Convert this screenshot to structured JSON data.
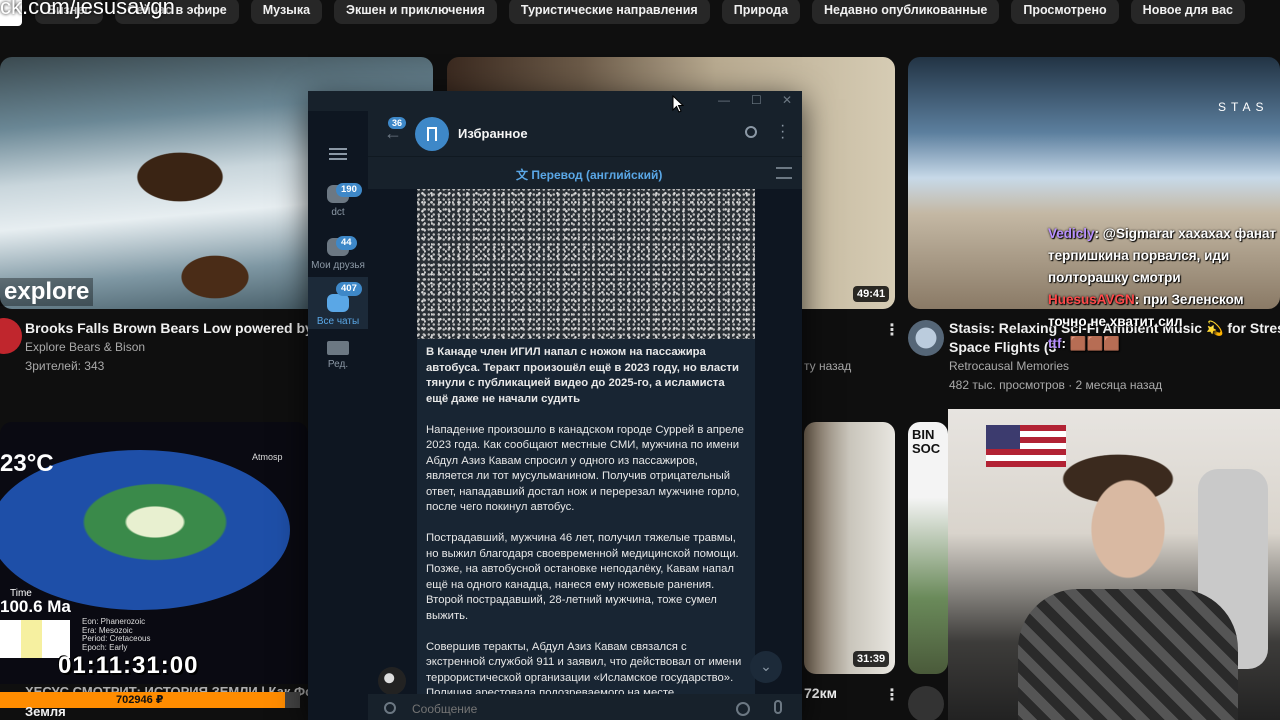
{
  "overlay_url": "ck.com/jesusavgn",
  "chips": [
    "Бизнес",
    "Сейчас в эфире",
    "Музыка",
    "Экшен и приключения",
    "Туристические направления",
    "Природа",
    "Недавно опубликованные",
    "Просмотрено",
    "Новое для вас"
  ],
  "videos": {
    "bears": {
      "logo": "explore",
      "title": "Brooks Falls Brown Bears Low powered by  EX",
      "channel": "Explore Bears & Bison",
      "views": "Зрителей: 343"
    },
    "room": {
      "duration": "49:41",
      "meta_fragment": "ту назад"
    },
    "ship": {
      "logo_text": "STAS",
      "title_line1": "Stasis: Relaxing Sci-Fi Ambient Music",
      "title_tail": "for Stress",
      "title_line2": "Space Flights (3",
      "channel": "Retrocausal Memories",
      "meta": "482 тыс. просмотров · 2 месяца назад"
    },
    "earth": {
      "temp": "23°C",
      "atmosphere": "Atmosp",
      "time_label": "Time",
      "time_value": "100.6 Ma",
      "era_lines": [
        "Eon:       Phanerozoic",
        "Era:       Mesozoic",
        "Period:   Cretaceous",
        "Epoch:    Early"
      ],
      "title": "ХЕСУС СМОТРИТ: ИСТОРИЯ ЗЕМЛИ | Как Фо",
      "channel": "Земля"
    },
    "forest": {
      "duration": "31:39",
      "views_fragment": "72км"
    },
    "bin": {
      "logo_text": "BIN SOC"
    }
  },
  "stream": {
    "timer": "01:11:31:00",
    "donate_amount": "702946 ₽"
  },
  "chat_overlay": [
    {
      "nick": "Vedicly",
      "text": ": @Sigmarar хахахах фанат терпишкина порвался, иди полторашку смотри"
    },
    {
      "nick": "HuesusAVGN",
      "text": ": при Зеленском точно не хватит сил"
    },
    {
      "nick": "ttf",
      "text": ":"
    }
  ],
  "telegram": {
    "window_controls": {
      "minimize": "—",
      "maximize": "☐",
      "close": "✕"
    },
    "sidebar": [
      {
        "label": "dct",
        "badge": "190"
      },
      {
        "label": "Мои друзья",
        "badge": "44"
      },
      {
        "label": "Все чаты",
        "badge": "407"
      },
      {
        "label": "Ред.",
        "badge": ""
      }
    ],
    "back_badge": "36",
    "chat_title": "Избранное",
    "translate_label": "Перевод (английский)",
    "message": {
      "headline": "В Канаде член ИГИЛ напал с ножом на пассажира автобуса. Теракт произошёл ещё в 2023 году, но власти тянули с публикацией видео до 2025-го, а исламиста ещё даже не начали судить",
      "p1": "Нападение произошло в канадском городе Суррей в апреле 2023 года. Как сообщают местные СМИ, мужчина по имени Абдул Азиз Кавам спросил у одного из пассажиров, является ли тот мусульманином. Получив отрицательный ответ, нападавший достал нож и перерезал мужчине горло, после чего покинул автобус.",
      "p2": "Пострадавший, мужчина 46 лет, получил тяжелые травмы, но выжил благодаря своевременной медицинской помощи. Позже, на автобусной остановке неподалёку, Кавам напал ещё на одного канадца, нанеся ему ножевые ранения. Второй пострадавший, 28-летний мужчина, тоже сумел выжить.",
      "p3": "Совершив теракты, Абдул Азиз Кавам связался с экстренной службой 911 и заявил, что действовал от имени террористической организации «Исламское государство». Полиция арестовала подозреваемого на месте"
    },
    "input_placeholder": "Сообщение"
  }
}
